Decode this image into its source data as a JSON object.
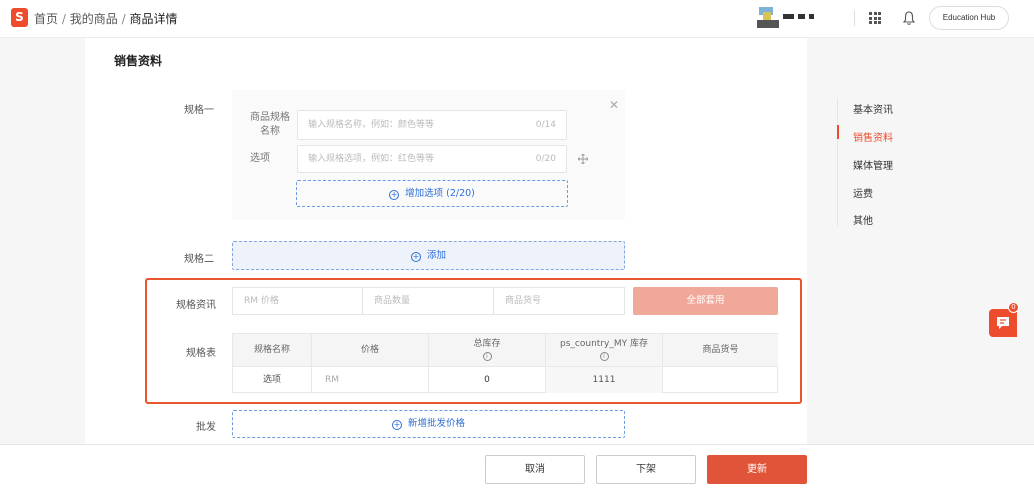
{
  "breadcrumb": {
    "home": "首页",
    "products": "我的商品",
    "current": "商品详情",
    "separator": "/"
  },
  "header": {
    "logo_glyph": "S",
    "edu_hub": "Education Hub"
  },
  "section_title": "销售资料",
  "variation1": {
    "label": "规格一",
    "name_label": "商品规格名称",
    "name_placeholder": "输入规格名称，例如：颜色等等",
    "name_count": "0/14",
    "option_label": "选项",
    "option_placeholder": "输入规格选项，例如：红色等等",
    "option_count": "0/20",
    "add_option": "增加选项 (2/20)"
  },
  "variation2": {
    "label": "规格二",
    "add_label": "添加"
  },
  "variant_info": {
    "label": "规格资讯",
    "price_placeholder": "RM 价格",
    "qty_placeholder": "商品数量",
    "sku_placeholder": "商品货号",
    "apply_all": "全部套用"
  },
  "variant_table": {
    "label": "规格表",
    "headers": [
      "规格名称",
      "价格",
      "总库存",
      "ps_country_MY 库存",
      "商品货号"
    ],
    "row": {
      "name": "选项",
      "price": "RM",
      "total_stock": "0",
      "country_stock": "1111",
      "sku": ""
    }
  },
  "wholesale": {
    "label": "批发",
    "add_label": "新增批发价格"
  },
  "right_nav": {
    "items": [
      "基本资讯",
      "销售资料",
      "媒体管理",
      "运费",
      "其他"
    ],
    "active_index": 1,
    "active_color": "#ee4d2d"
  },
  "chat": {
    "badge": "0"
  },
  "footer": {
    "cancel": "取消",
    "delist": "下架",
    "update": "更新"
  },
  "colors": {
    "brand": "#ee4d2d",
    "link": "#2d6fd6"
  }
}
